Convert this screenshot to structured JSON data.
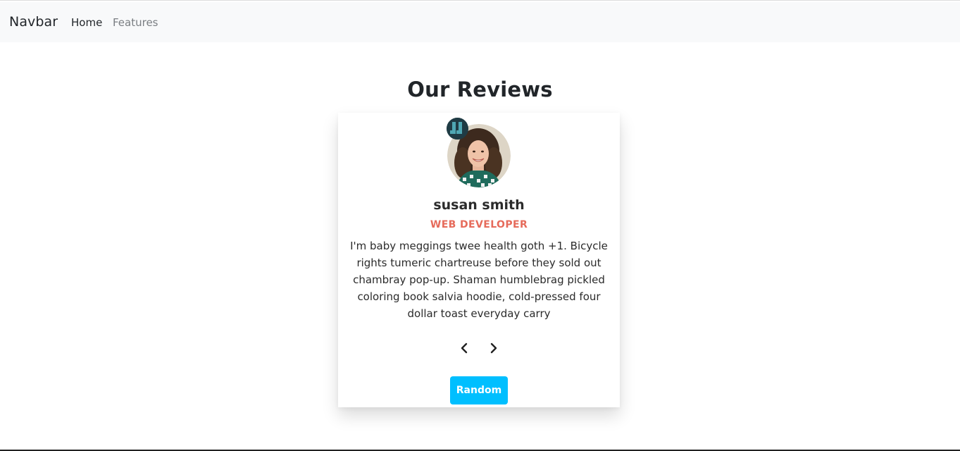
{
  "navbar": {
    "brand": "Navbar",
    "links": [
      {
        "label": "Home",
        "active": true
      },
      {
        "label": "Features",
        "active": false
      }
    ]
  },
  "section": {
    "title": "Our Reviews"
  },
  "review": {
    "name": "susan smith",
    "job": "WEB DEVELOPER",
    "text": "I'm baby meggings twee health goth +1. Bicycle rights tumeric chartreuse before they sold out chambray pop-up. Shaman humblebrag pickled coloring book salvia hoodie, cold-pressed four dollar toast everyday carry",
    "prev_icon": "chevron-left-icon",
    "next_icon": "chevron-right-icon",
    "quote_icon": "quote-icon"
  },
  "actions": {
    "random_label": "Random"
  },
  "colors": {
    "navbar_bg": "#f8f9fa",
    "job_accent": "#e66b5b",
    "random_button": "#00bfff",
    "quote_badge": "#1f3b44"
  }
}
